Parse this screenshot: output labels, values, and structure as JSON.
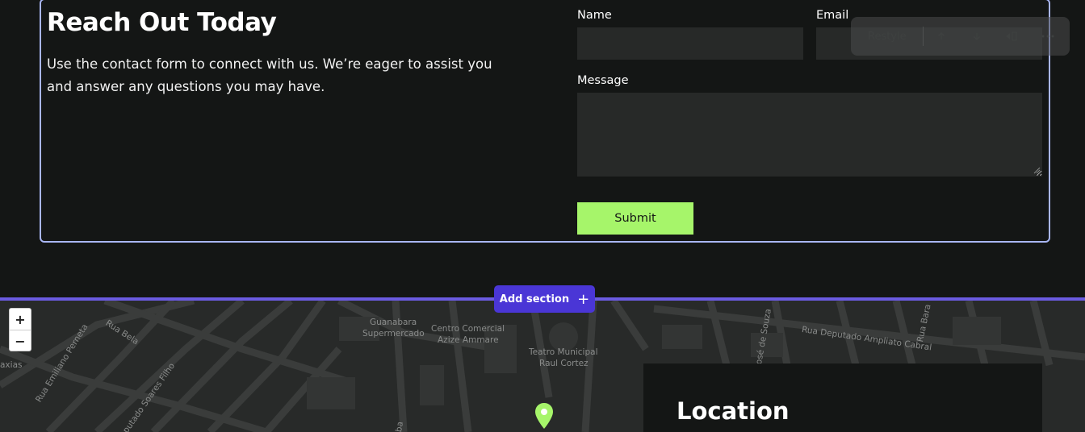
{
  "contact": {
    "title": "Reach Out Today",
    "description": "Use the contact form to connect with us. We’re eager to assist you and answer any questions you may have.",
    "name_label": "Name",
    "email_label": "Email",
    "message_label": "Message",
    "name_value": "",
    "email_value": "",
    "message_value": "",
    "submit_label": "Submit"
  },
  "toolbar": {
    "restyle_label": "Restyle",
    "move_up_icon": "arrow-up-icon",
    "move_down_icon": "arrow-down-icon",
    "align_icon": "align-icon",
    "more_icon": "more-icon"
  },
  "builder": {
    "add_section_label": "Add section",
    "add_section_icon": "plus-icon"
  },
  "map": {
    "zoom_in": "+",
    "zoom_out": "−",
    "labels": [
      "Rua Bela",
      "Rua Emiliano Perneta",
      "putado Soares Filho",
      "axias",
      "Guanabara",
      "Supermercado",
      "Centro Comercial",
      "Azize Ammare",
      "Teatro Municipal",
      "Raul Cortez",
      "Rua Deputado Ampliato Cabral",
      "osé de Souza",
      "Rua Bara",
      "ba"
    ]
  },
  "location": {
    "title": "Location"
  },
  "colors": {
    "background": "#141615",
    "accent_border": "#a9b6f5",
    "submit": "#a6f56a",
    "builder_accent": "#4a36d6",
    "marker": "#a6f56a"
  }
}
